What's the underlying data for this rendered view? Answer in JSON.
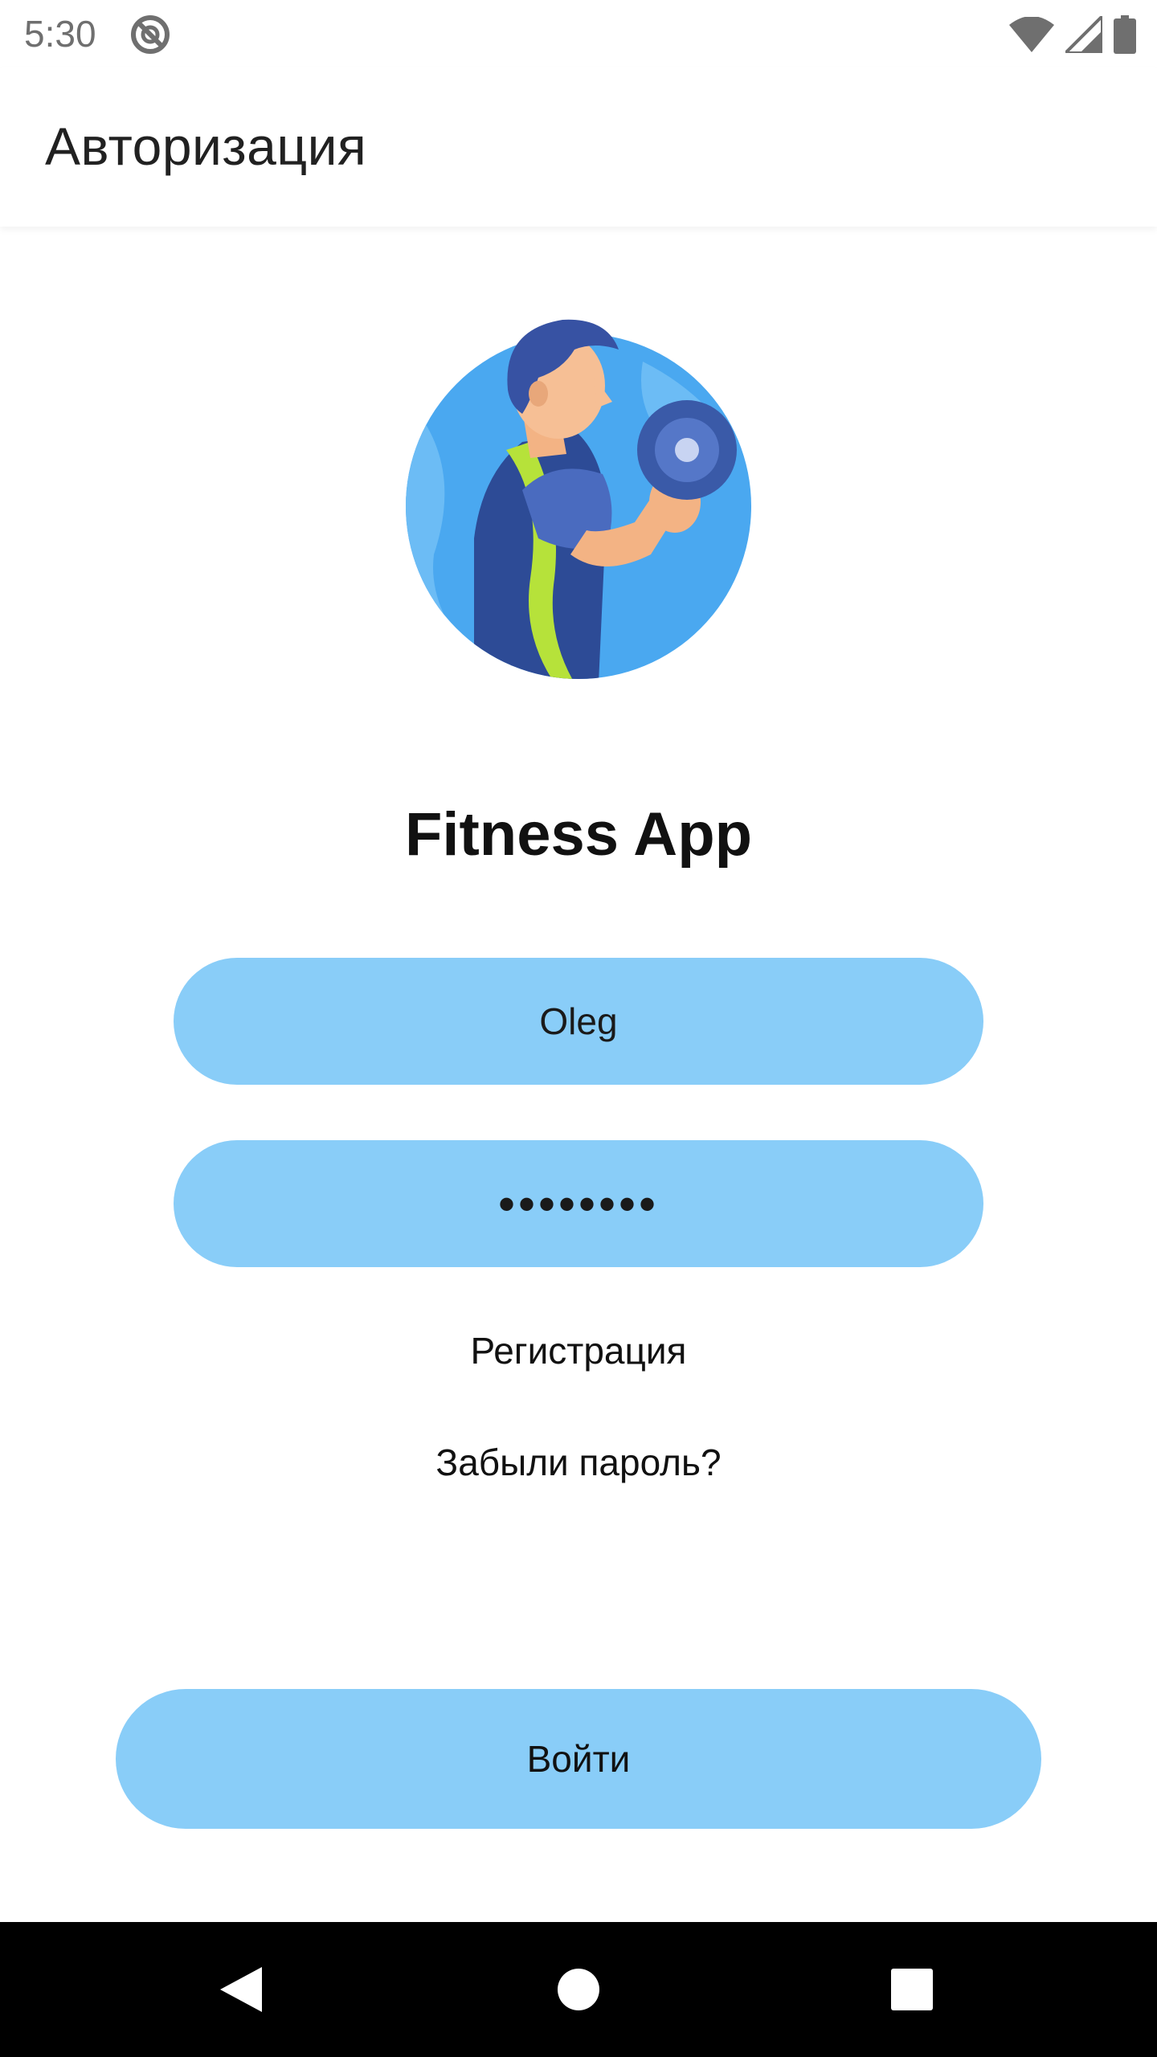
{
  "status_bar": {
    "time": "5:30",
    "icons": [
      "blocked-icon",
      "wifi-icon",
      "signal-icon",
      "battery-icon"
    ]
  },
  "app_bar": {
    "title": "Авторизация"
  },
  "logo": {
    "icon": "fitness-man-dumbbell-icon"
  },
  "app_name": "Fitness App",
  "form": {
    "username_value": "Oleg",
    "password_value": "11111111"
  },
  "links": {
    "register": "Регистрация",
    "forgot_password": "Забыли пароль?"
  },
  "login_button": {
    "label": "Войти"
  },
  "nav_bar": {
    "icons": [
      "back-icon",
      "home-icon",
      "recents-icon"
    ]
  },
  "colors": {
    "accent": "#89cdf8",
    "text": "#111111",
    "nav_background": "#000000"
  }
}
